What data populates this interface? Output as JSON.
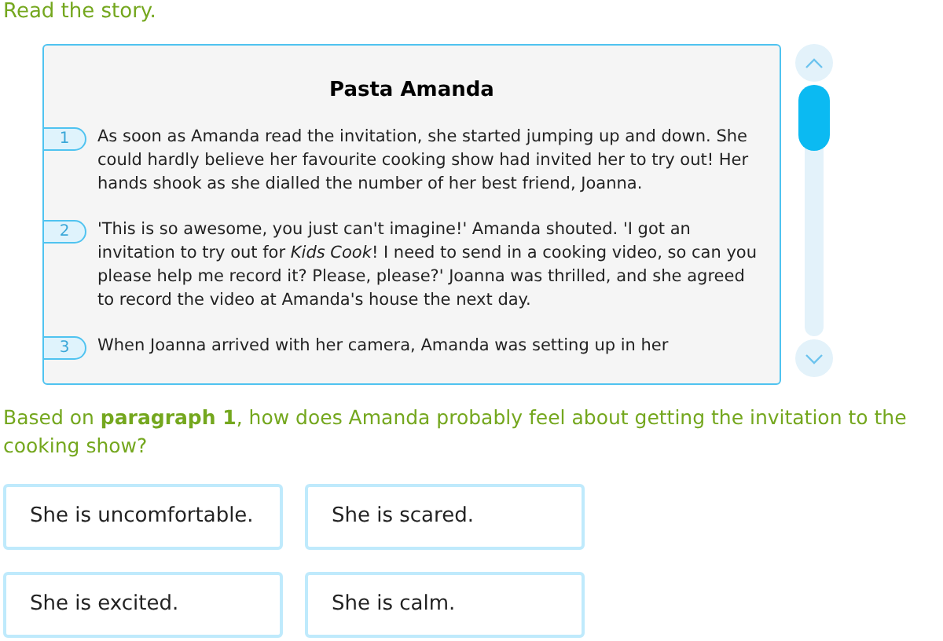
{
  "instruction": "Read the story.",
  "story": {
    "title": "Pasta Amanda",
    "paragraphs": [
      {
        "number": "1",
        "text": "As soon as Amanda read the invitation, she started jumping up and down. She could hardly believe her favourite cooking show had invited her to try out! Her hands shook as she dialled the number of her best friend, Joanna."
      },
      {
        "number": "2",
        "text": "'This is so awesome, you just can't imagine!' Amanda shouted. 'I got an invitation to try out for *Kids Cook*! I need to send in a cooking video, so can you please help me record it? Please, please?' Joanna was thrilled, and she agreed to record the video at Amanda's house the next day."
      },
      {
        "number": "3",
        "text": "When Joanna arrived with her camera, Amanda was setting up in her"
      }
    ]
  },
  "question": "Based on **paragraph 1**, how does Amanda probably feel about getting the invitation to the cooking show?",
  "options": [
    "She is uncomfortable.",
    "She is scared.",
    "She is excited.",
    "She is calm."
  ]
}
